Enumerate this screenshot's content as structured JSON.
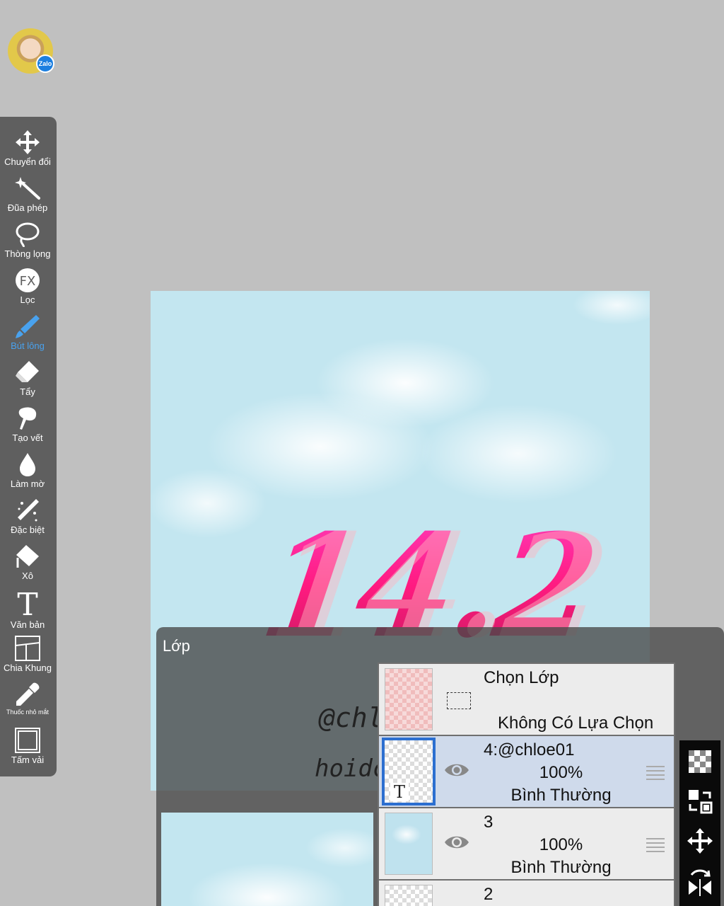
{
  "avatar": {
    "badge_label": "Zalo"
  },
  "toolbar": {
    "tools": [
      {
        "label": "Chuyển đổi",
        "icon": "move-arrows-icon"
      },
      {
        "label": "Đũa phép",
        "icon": "magic-wand-icon"
      },
      {
        "label": "Thòng lọng",
        "icon": "lasso-icon"
      },
      {
        "label": "Lọc",
        "icon": "fx-filter-icon"
      },
      {
        "label": "Bút lông",
        "icon": "brush-icon",
        "active": true
      },
      {
        "label": "Tẩy",
        "icon": "eraser-icon"
      },
      {
        "label": "Tạo vết",
        "icon": "smudge-icon"
      },
      {
        "label": "Làm mờ",
        "icon": "blur-drop-icon"
      },
      {
        "label": "Đặc biệt",
        "icon": "special-pen-icon"
      },
      {
        "label": "Xô",
        "icon": "bucket-icon"
      },
      {
        "label": "Văn bản",
        "icon": "text-icon"
      },
      {
        "label": "Chia Khung",
        "icon": "frame-divide-icon"
      },
      {
        "label": "Thuốc nhỏ mắt",
        "icon": "eyedropper-icon"
      },
      {
        "label": "Tấm vải",
        "icon": "canvas-icon"
      }
    ],
    "active_color": "#49a2ee"
  },
  "canvas": {
    "artwork_text": "14.2"
  },
  "layer_panel": {
    "title": "Lớp",
    "canvas_handle_1": "@chl",
    "canvas_handle_2": "hoidc",
    "selection_row": {
      "title": "Chọn Lớp",
      "subtitle": "Không Có Lựa Chọn"
    },
    "layers": [
      {
        "name": "4:@chloe01",
        "opacity": "100%",
        "mode": "Bình Thường",
        "selected": true,
        "type": "text"
      },
      {
        "name": "3",
        "opacity": "100%",
        "mode": "Bình Thường",
        "selected": false,
        "type": "image"
      },
      {
        "name": "2"
      }
    ]
  },
  "right_bar": {
    "buttons": [
      "transparency-checker-icon",
      "swap-layer-icon",
      "move-layer-icon",
      "flip-icon"
    ]
  }
}
